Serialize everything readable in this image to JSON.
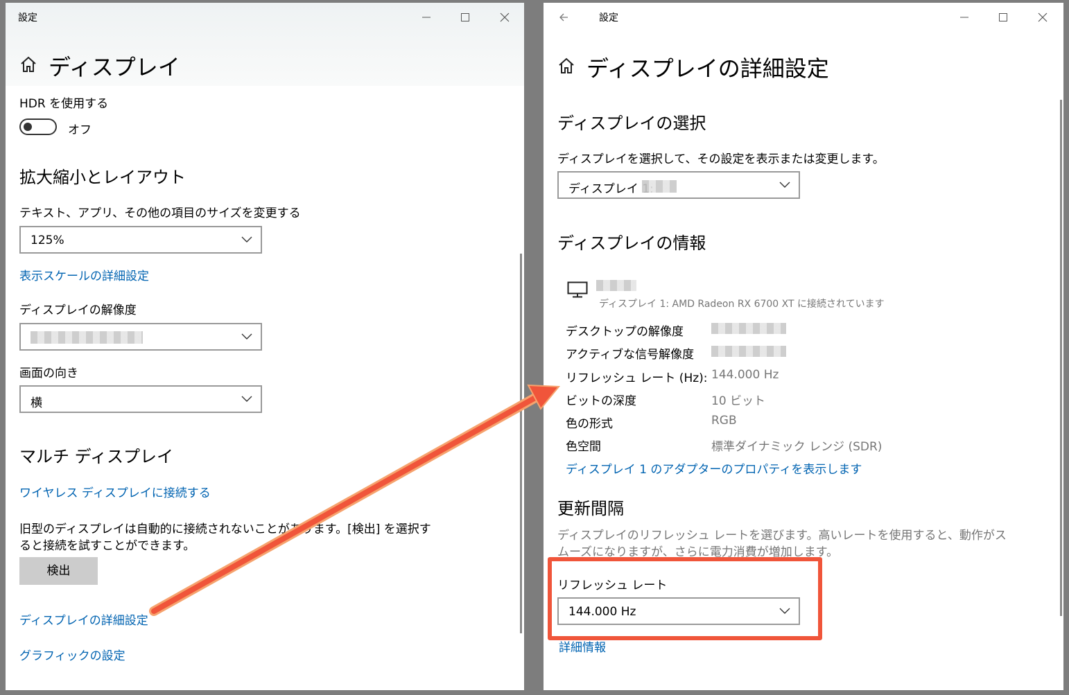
{
  "left": {
    "window_title": "設定",
    "page_title": "ディスプレイ",
    "hdr_label": "HDR を使用する",
    "hdr_state": "オフ",
    "section_scale": "拡大縮小とレイアウト",
    "text_size_label": "テキスト、アプリ、その他の項目のサイズを変更する",
    "scale_value": "125%",
    "advanced_scale_link": "表示スケールの詳細設定",
    "resolution_label": "ディスプレイの解像度",
    "orientation_label": "画面の向き",
    "orientation_value": "横",
    "section_multi": "マルチ ディスプレイ",
    "wireless_link": "ワイヤレス ディスプレイに接続する",
    "detect_desc_1": "旧型のディスプレイは自動的に接続されないことがあります。[検出] を選択す",
    "detect_desc_2": "ると接続を試すことができます。",
    "detect_button": "検出",
    "advanced_display_link": "ディスプレイの詳細設定",
    "graphics_link": "グラフィックの設定"
  },
  "right": {
    "window_title": "設定",
    "page_title": "ディスプレイの詳細設定",
    "section_select": "ディスプレイの選択",
    "select_desc": "ディスプレイを選択して、その設定を表示または変更します。",
    "display_select_value": "ディスプレイ 1:",
    "section_info": "ディスプレイの情報",
    "monitor_subtitle": "ディスプレイ 1: AMD Radeon RX 6700 XT に接続されています",
    "info_rows": [
      {
        "key": "デスクトップの解像度",
        "value": ""
      },
      {
        "key": "アクティブな信号解像度",
        "value": ""
      },
      {
        "key": "リフレッシュ レート (Hz):",
        "value": "144.000 Hz"
      },
      {
        "key": "ビットの深度",
        "value": "10 ビット"
      },
      {
        "key": "色の形式",
        "value": "RGB"
      },
      {
        "key": "色空間",
        "value": "標準ダイナミック レンジ (SDR)"
      }
    ],
    "adapter_link": "ディスプレイ 1 のアダプターのプロパティを表示します",
    "section_refresh": "更新間隔",
    "refresh_desc_1": "ディスプレイのリフレッシュ レートを選びます。高いレートを使用すると、動作がス",
    "refresh_desc_2": "ムーズになりますが、さらに電力消費が増加します。",
    "refresh_label": "リフレッシュ レート",
    "refresh_value": "144.000 Hz",
    "details_link": "詳細情報"
  },
  "colors": {
    "link": "#0063b1",
    "annotation": "#f0553a",
    "background": "#7d7d7d"
  },
  "icons": [
    "home-icon",
    "minimize-icon",
    "maximize-icon",
    "close-icon",
    "back-arrow-icon",
    "chevron-down-icon",
    "monitor-icon",
    "annotation-arrow"
  ]
}
